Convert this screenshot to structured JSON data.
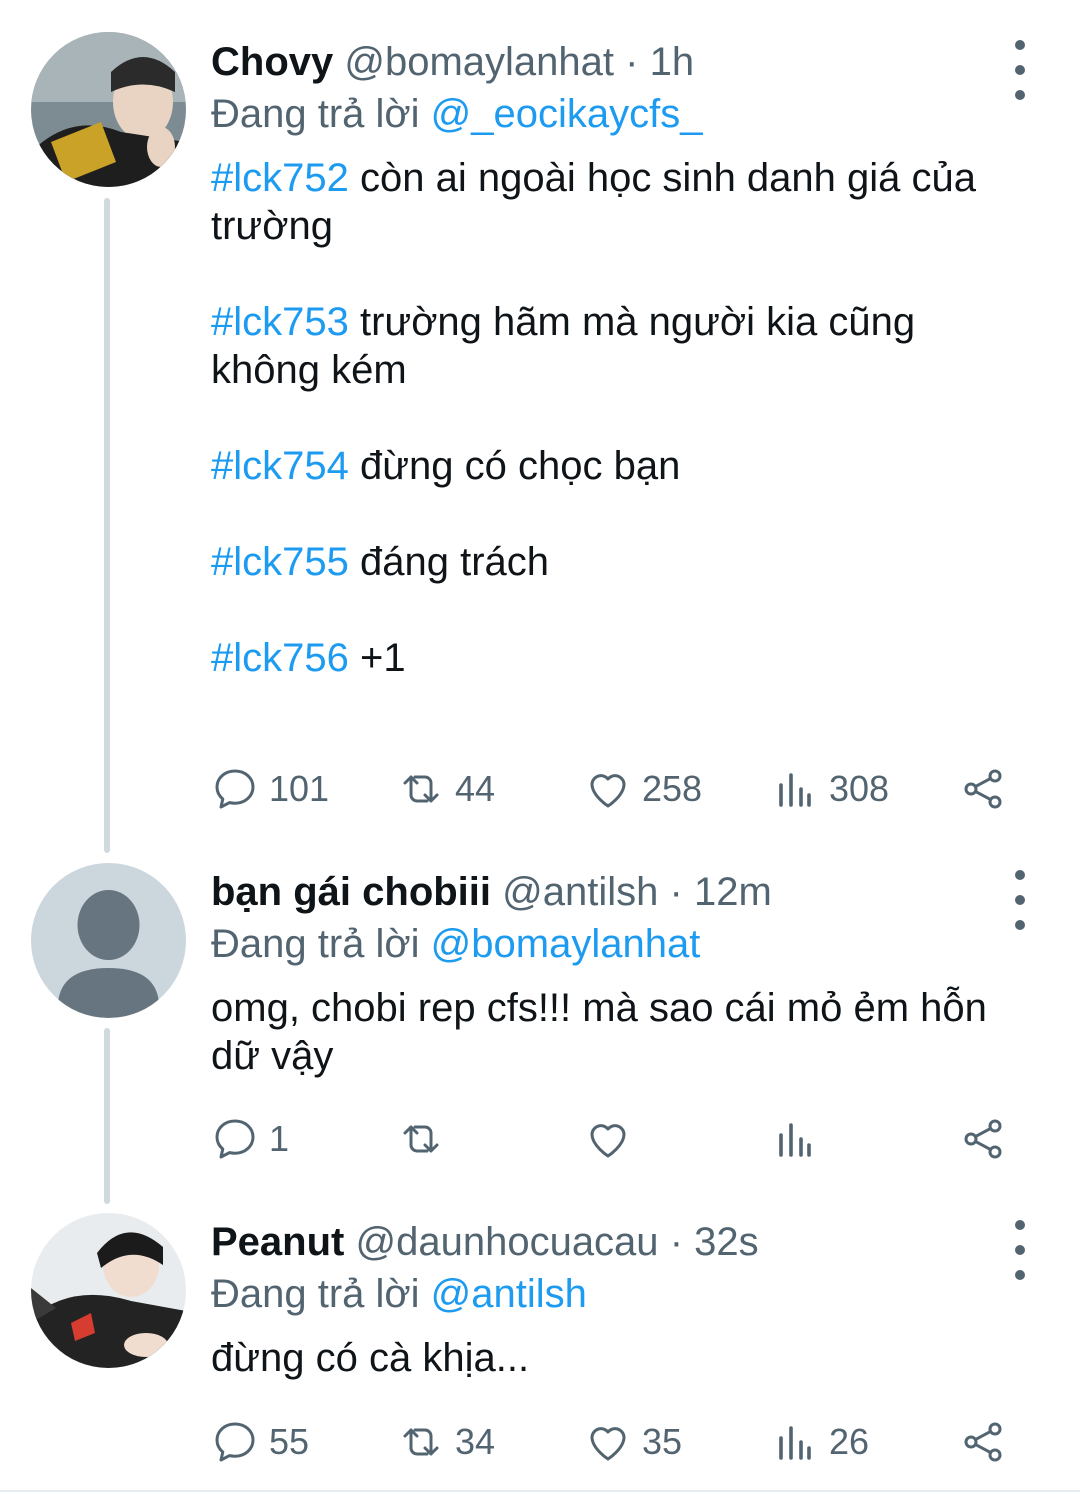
{
  "colors": {
    "accent": "#1d9bf0",
    "muted": "#536471",
    "text": "#0f1419",
    "thread_line": "#cfd9de"
  },
  "tweets": [
    {
      "display_name": "Chovy",
      "handle": "@bomaylanhat",
      "separator": "·",
      "time": "1h",
      "replying_prefix": "Đang trả lời",
      "replying_to": "@_eocikaycfs_",
      "paragraphs": [
        {
          "tag": "#lck752",
          "text": " còn ai ngoài học sinh danh giá của trường"
        },
        {
          "tag": "#lck753",
          "text": " trường hãm mà người kia cũng không kém"
        },
        {
          "tag": "#lck754",
          "text": " đừng có chọc bạn"
        },
        {
          "tag": "#lck755",
          "text": " đáng trách"
        },
        {
          "tag": "#lck756",
          "text": " +1"
        }
      ],
      "stats": {
        "replies": "101",
        "retweets": "44",
        "likes": "258",
        "views": "308"
      }
    },
    {
      "display_name": "bạn gái chobiii",
      "handle": "@antilsh",
      "separator": "·",
      "time": "12m",
      "replying_prefix": "Đang trả lời",
      "replying_to": "@bomaylanhat",
      "paragraphs": [
        {
          "tag": "",
          "text": "omg, chobi rep cfs!!! mà sao cái mỏ ẻm hỗn dữ vậy"
        }
      ],
      "stats": {
        "replies": "1",
        "retweets": "",
        "likes": "",
        "views": ""
      }
    },
    {
      "display_name": "Peanut",
      "handle": "@daunhocuacau",
      "separator": "·",
      "time": "32s",
      "replying_prefix": "Đang trả lời",
      "replying_to": "@antilsh",
      "paragraphs": [
        {
          "tag": "",
          "text": "đừng có cà khịa..."
        }
      ],
      "stats": {
        "replies": "55",
        "retweets": "34",
        "likes": "35",
        "views": "26"
      }
    }
  ],
  "icons": {
    "reply": "speech-bubble-icon",
    "retweet": "retweet-icon",
    "like": "heart-icon",
    "views": "bar-chart-icon",
    "share": "share-icon",
    "more": "vertical-ellipsis-icon",
    "default_avatar": "person-silhouette-icon"
  }
}
